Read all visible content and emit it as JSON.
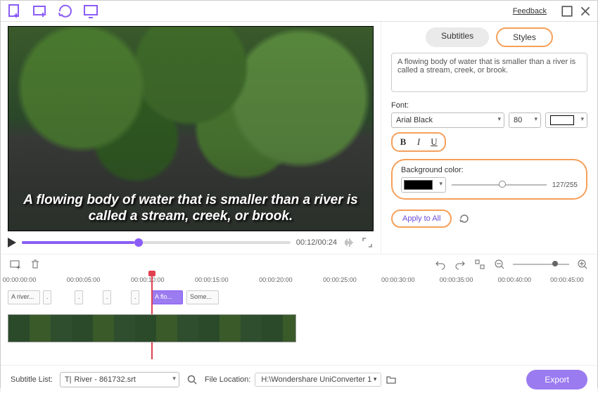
{
  "topbar": {
    "feedback": "Feedback"
  },
  "preview": {
    "subtitle_text": "A flowing body of water that is smaller than a river is called a stream, creek, or brook.",
    "time": "00:12/00:24"
  },
  "side": {
    "tabs": {
      "subtitles": "Subtitles",
      "styles": "Styles"
    },
    "text_value": "A flowing body of water that is smaller than a river is called a stream, creek, or brook.",
    "font_label": "Font:",
    "font_family": "Arial Black",
    "font_size": "80",
    "bg_label": "Background color:",
    "opacity": "127/255",
    "apply": "Apply to All"
  },
  "ruler": [
    "00:00:00:00",
    "00:00:05:00",
    "00:00:10:00",
    "00:00:15:00",
    "00:00:20:00",
    "00:00:25:00",
    "00:00:30:00",
    "00:00:35:00",
    "00:00:40:00",
    "00:00:45:00"
  ],
  "clips": {
    "c0": "A river...",
    "active": "A flo...",
    "after": "Some..."
  },
  "bottom": {
    "subtitle_list_label": "Subtitle List:",
    "subtitle_file": "River - 861732.srt",
    "file_loc_label": "File Location:",
    "file_loc_value": "H:\\Wondershare UniConverter 1",
    "export": "Export"
  }
}
